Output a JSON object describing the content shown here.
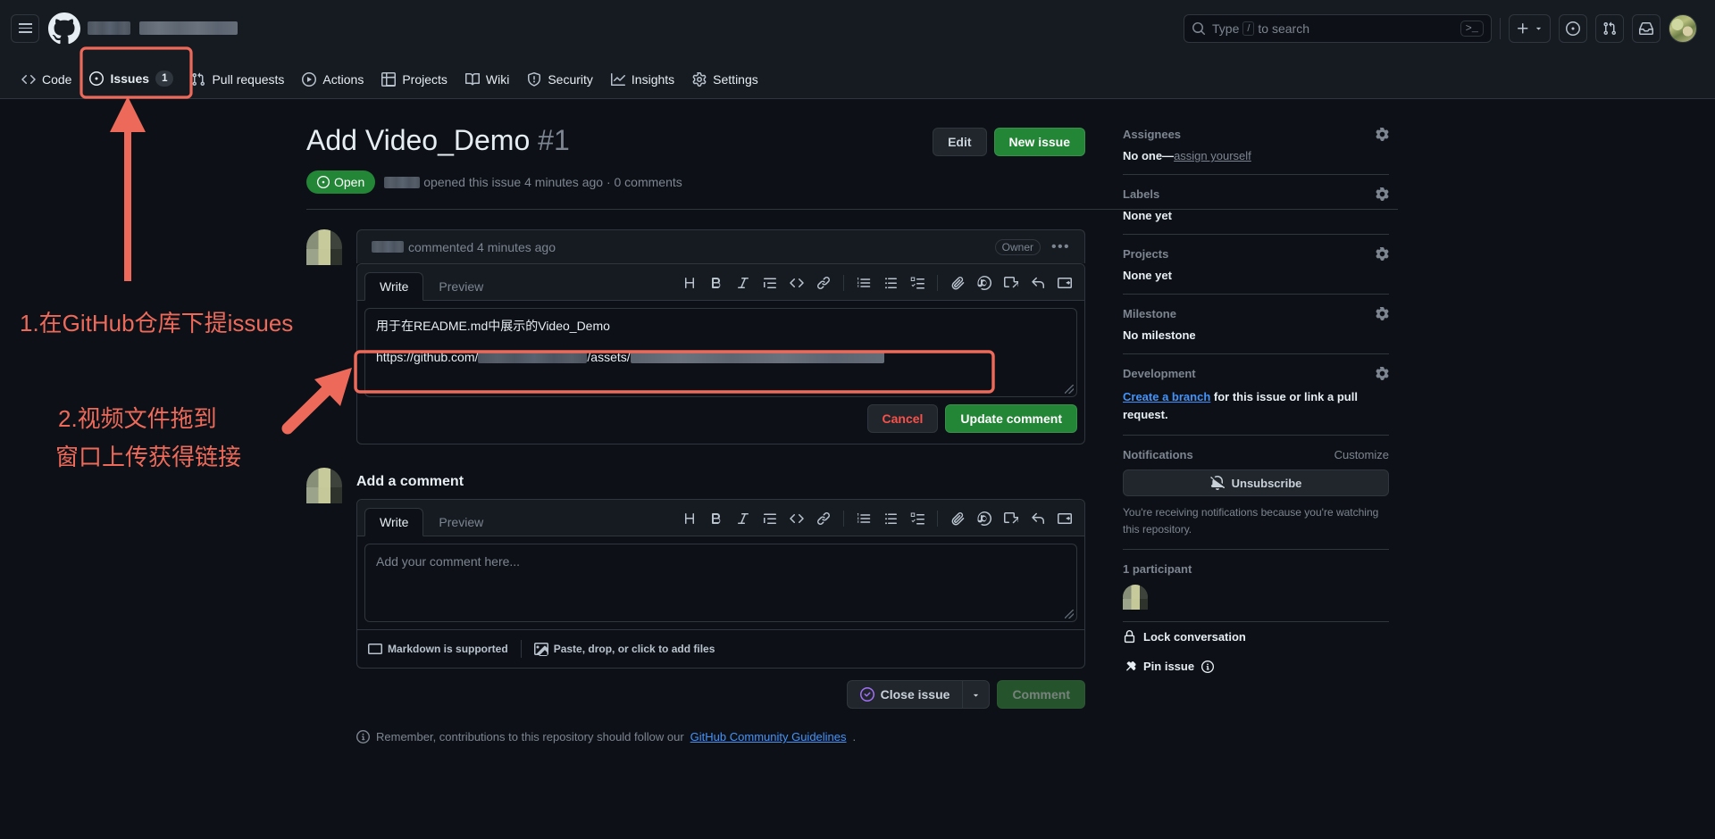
{
  "header": {
    "menu_icon": "hamburger-icon",
    "logo_icon": "github-logo-icon",
    "owner_redacted": "",
    "repo_redacted": "",
    "search": {
      "placeholder_prefix": "Type",
      "slash_key": "/",
      "placeholder_suffix": "to search"
    },
    "terminal_label": ">_",
    "icons": [
      "plus-icon",
      "chevron-down-icon",
      "issues-icon",
      "pull-requests-icon",
      "inbox-icon",
      "avatar"
    ]
  },
  "repo_nav": {
    "tabs": [
      {
        "label": "Code",
        "icon": "code-icon",
        "count": null,
        "active": false
      },
      {
        "label": "Issues",
        "icon": "issue-opened-icon",
        "count": "1",
        "active": true
      },
      {
        "label": "Pull requests",
        "icon": "git-pull-request-icon",
        "count": null,
        "active": false
      },
      {
        "label": "Actions",
        "icon": "play-icon",
        "count": null,
        "active": false
      },
      {
        "label": "Projects",
        "icon": "table-icon",
        "count": null,
        "active": false
      },
      {
        "label": "Wiki",
        "icon": "book-icon",
        "count": null,
        "active": false
      },
      {
        "label": "Security",
        "icon": "shield-icon",
        "count": null,
        "active": false
      },
      {
        "label": "Insights",
        "icon": "graph-icon",
        "count": null,
        "active": false
      },
      {
        "label": "Settings",
        "icon": "gear-icon",
        "count": null,
        "active": false
      }
    ]
  },
  "issue": {
    "title": "Add Video_Demo",
    "number": "#1",
    "state": "Open",
    "meta_suffix": "opened this issue 4 minutes ago · 0 comments",
    "edit_label": "Edit",
    "new_issue_label": "New issue"
  },
  "comment": {
    "header_suffix": "commented 4 minutes ago",
    "role_badge": "Owner",
    "kebab": "•••",
    "tabs": {
      "write": "Write",
      "preview": "Preview"
    },
    "toolbar_icons": [
      "heading-icon",
      "bold-icon",
      "italic-icon",
      "quote-icon",
      "code-icon",
      "link-icon",
      "ordered-list-icon",
      "unordered-list-icon",
      "task-list-icon",
      "attachment-icon",
      "mention-icon",
      "reference-icon",
      "reply-icon",
      "markdown-icon"
    ],
    "body_line1": "用于在README.md中展示的Video_Demo",
    "body_line2_prefix": "https://github.com/",
    "body_line2_middle": "/assets/",
    "cancel_label": "Cancel",
    "update_label": "Update comment"
  },
  "add_comment": {
    "title": "Add a comment",
    "tabs": {
      "write": "Write",
      "preview": "Preview"
    },
    "placeholder": "Add your comment here...",
    "markdown_note": "Markdown is supported",
    "paste_note": "Paste, drop, or click to add files",
    "close_issue_label": "Close issue",
    "comment_label": "Comment",
    "guideline_prefix": "Remember, contributions to this repository should follow our",
    "guideline_link": "GitHub Community Guidelines",
    "guideline_suffix": "."
  },
  "sidebar": {
    "sections": [
      {
        "title": "Assignees",
        "value": "No one—",
        "link": "assign yourself"
      },
      {
        "title": "Labels",
        "value": "None yet"
      },
      {
        "title": "Projects",
        "value": "None yet"
      },
      {
        "title": "Milestone",
        "value": "No milestone"
      }
    ],
    "development": {
      "title": "Development",
      "link": "Create a branch",
      "text": " for this issue or link a pull request."
    },
    "notifications": {
      "title": "Notifications",
      "customize": "Customize",
      "button": "Unsubscribe",
      "button_icon": "bell-slash-icon",
      "note": "You're receiving notifications because you're watching this repository."
    },
    "participants": {
      "count_label": "1 participant"
    },
    "actions": [
      {
        "label": "Lock conversation",
        "icon": "lock-icon"
      },
      {
        "label": "Pin issue",
        "icon": "pin-icon",
        "info_icon": "info-icon"
      }
    ]
  },
  "annotations": {
    "step1": "1.在GitHub仓库下提issues",
    "step2_line1": "2.视频文件拖到",
    "step2_line2": "窗口上传获得链接",
    "accent_color": "#ed6a5a"
  }
}
